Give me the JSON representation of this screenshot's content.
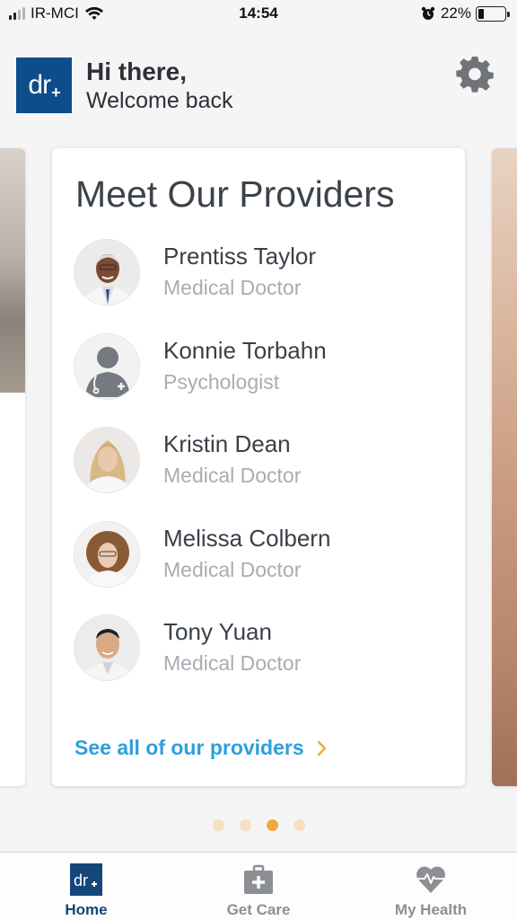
{
  "status_bar": {
    "carrier": "IR-MCI",
    "time": "14:54",
    "battery": "22%",
    "battery_level": 0.22
  },
  "header": {
    "logo_text": "dr",
    "logo_mark": "+",
    "greeting": "Hi there,",
    "subtitle": "Welcome back",
    "settings_icon": "gear-icon"
  },
  "card": {
    "title": "Meet Our Providers",
    "providers": [
      {
        "name": "Prentiss Taylor",
        "role": "Medical Doctor"
      },
      {
        "name": "Konnie Torbahn",
        "role": "Psychologist"
      },
      {
        "name": "Kristin Dean",
        "role": "Medical Doctor"
      },
      {
        "name": "Melissa Colbern",
        "role": "Medical Doctor"
      },
      {
        "name": "Tony Yuan",
        "role": "Medical Doctor"
      }
    ],
    "see_all": "See all of our providers"
  },
  "pagination": {
    "count": 4,
    "active_index": 2
  },
  "tabbar": {
    "items": [
      {
        "label": "Home",
        "icon": "home-logo-icon",
        "active": true
      },
      {
        "label": "Get Care",
        "icon": "medical-kit-icon",
        "active": false
      },
      {
        "label": "My Health",
        "icon": "heart-pulse-icon",
        "active": false
      }
    ]
  },
  "colors": {
    "brand": "#0d4d8c",
    "link": "#2d9fdc",
    "accent": "#f0aa3d",
    "tab_active": "#15467a",
    "tab_inactive": "#8c8f93"
  }
}
